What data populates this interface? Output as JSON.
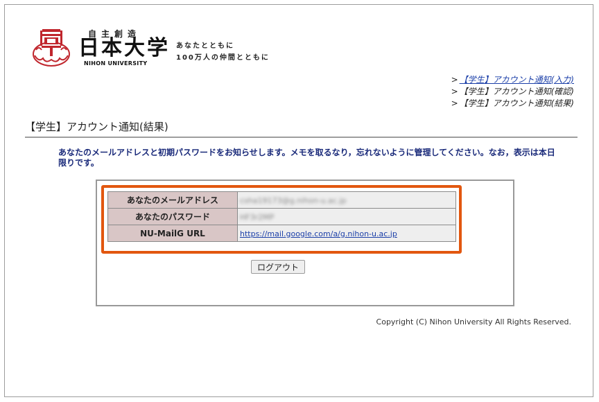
{
  "header": {
    "motto": "自主創造",
    "university_jp": "日本大学",
    "university_en": "NIHON UNIVERSITY",
    "slogan_line1": "あなたとともに",
    "slogan_line2": "100万人の仲間とともに"
  },
  "steps": [
    {
      "arrow": ">",
      "label": "【学生】アカウント通知(入力)",
      "link": true
    },
    {
      "arrow": ">",
      "label": "【学生】アカウント通知(確認)",
      "link": false
    },
    {
      "arrow": ">",
      "label": "【学生】アカウント通知(結果)",
      "link": false
    }
  ],
  "page_title": "【学生】アカウント通知(結果)",
  "message": "あなたのメールアドレスと初期パスワードをお知らせします。メモを取るなり，忘れないように管理してください。なお，表示は本日限りです。",
  "info_table": {
    "rows": [
      {
        "label": "あなたのメールアドレス",
        "value": "csha19173@g.nihon-u.ac.jp",
        "type": "blurred"
      },
      {
        "label": "あなたのパスワード",
        "value": "HF3r2MP",
        "type": "blurred"
      },
      {
        "label": "NU-MailG URL",
        "value": "https://mail.google.com/a/g.nihon-u.ac.jp",
        "type": "link"
      }
    ]
  },
  "logout_label": "ログアウト",
  "copyright": "Copyright (C) Nihon University All Rights Reserved.",
  "colors": {
    "highlight": "#e2570f",
    "label_bg": "#d9c6c6",
    "link": "#1a3ea8",
    "message": "#1a2a7a",
    "logo_red": "#c0262d"
  }
}
